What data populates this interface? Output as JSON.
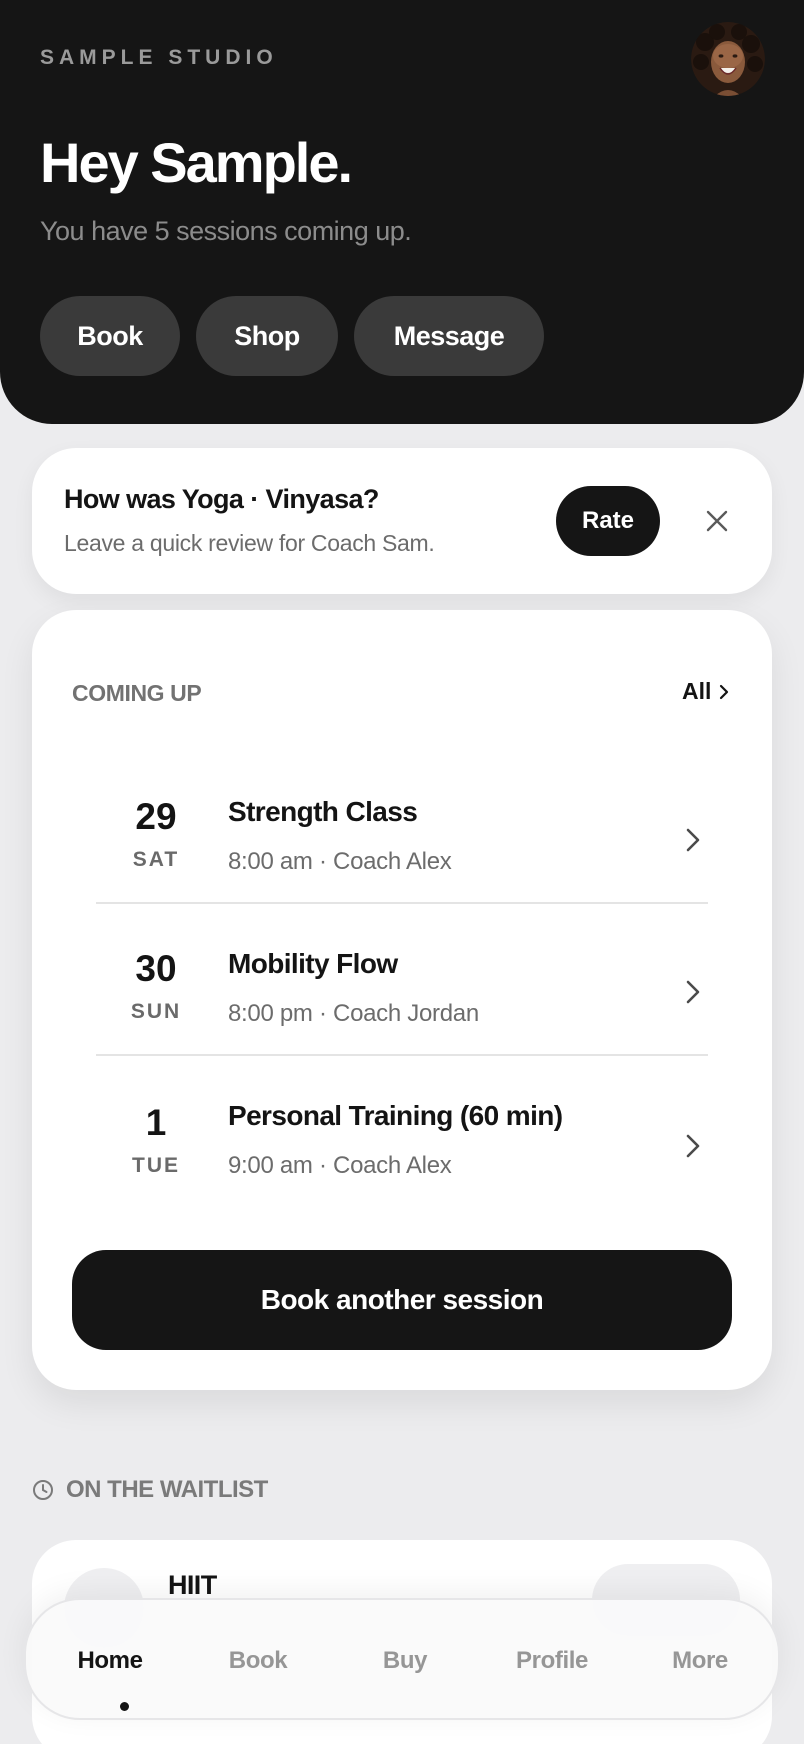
{
  "header": {
    "studio_name": "SAMPLE STUDIO",
    "greeting": "Hey Sample.",
    "subtitle": "You have 5 sessions coming up.",
    "actions": [
      {
        "label": "Book"
      },
      {
        "label": "Shop"
      },
      {
        "label": "Message"
      }
    ]
  },
  "review": {
    "title": "How was Yoga · Vinyasa?",
    "subtitle": "Leave a quick review for Coach Sam.",
    "rate_label": "Rate",
    "close_icon": "close-icon"
  },
  "upcoming": {
    "title": "COMING UP",
    "all_label": "All",
    "sessions": [
      {
        "day": "29",
        "weekday": "SAT",
        "name": "Strength Class",
        "meta": "8:00 am · Coach Alex"
      },
      {
        "day": "30",
        "weekday": "SUN",
        "name": "Mobility Flow",
        "meta": "8:00 pm · Coach Jordan"
      },
      {
        "day": "1",
        "weekday": "TUE",
        "name": "Personal Training (60 min)",
        "meta": "9:00 am · Coach Alex"
      }
    ],
    "book_label": "Book another session"
  },
  "waitlist": {
    "title": "ON THE WAITLIST",
    "icon": "clock-icon",
    "items": [
      {
        "name": "HIIT"
      }
    ]
  },
  "nav": {
    "items": [
      {
        "label": "Home",
        "active": true
      },
      {
        "label": "Book"
      },
      {
        "label": "Buy"
      },
      {
        "label": "Profile"
      },
      {
        "label": "More"
      }
    ]
  },
  "colors": {
    "hero_bg": "#151515",
    "page_bg": "#ececee",
    "card_bg": "#ffffff",
    "pill_bg": "#3a3a3a",
    "muted_text": "#6c6c6c"
  }
}
